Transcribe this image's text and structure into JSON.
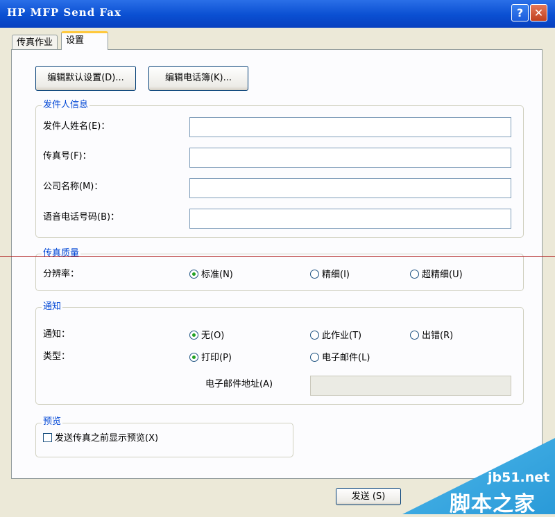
{
  "window": {
    "title": "HP MFP Send Fax",
    "help_glyph": "?",
    "close_glyph": "✕"
  },
  "tabs": [
    {
      "label": "传真作业",
      "active": false
    },
    {
      "label": "设置",
      "active": true
    }
  ],
  "top_buttons": {
    "edit_defaults": "编辑默认设置(D)...",
    "edit_phonebook": "编辑电话簿(K)..."
  },
  "sender": {
    "legend": "发件人信息",
    "fields": [
      {
        "label": "发件人姓名(E)：",
        "value": ""
      },
      {
        "label": "传真号(F)：",
        "value": ""
      },
      {
        "label": "公司名称(M)：",
        "value": ""
      },
      {
        "label": "语音电话号码(B)：",
        "value": ""
      }
    ]
  },
  "quality": {
    "legend": "传真质量",
    "label": "分辨率：",
    "options": [
      {
        "label": "标准(N)",
        "selected": true
      },
      {
        "label": "精细(I)",
        "selected": false
      },
      {
        "label": "超精细(U)",
        "selected": false
      }
    ]
  },
  "notify": {
    "legend": "通知",
    "notify_label": "通知：",
    "notify_options": [
      {
        "label": "无(O)",
        "selected": true
      },
      {
        "label": "此作业(T)",
        "selected": false
      },
      {
        "label": "出错(R)",
        "selected": false
      }
    ],
    "type_label": "类型：",
    "type_options": [
      {
        "label": "打印(P)",
        "selected": true
      },
      {
        "label": "电子邮件(L)",
        "selected": false
      }
    ],
    "email_label": "电子邮件地址(A)",
    "email_value": ""
  },
  "preview": {
    "legend": "预览",
    "checkbox_label": "发送传真之前显示预览(X)",
    "checked": false
  },
  "footer": {
    "send_label": "发送 (S)"
  },
  "watermark": {
    "site": "jb51.net",
    "name": "脚本之家"
  },
  "colors": {
    "title_bar": "#0a4fd2",
    "group_legend": "#0046d5",
    "radio_selected": "#21a121",
    "active_tab_accent": "#ffc83c"
  }
}
